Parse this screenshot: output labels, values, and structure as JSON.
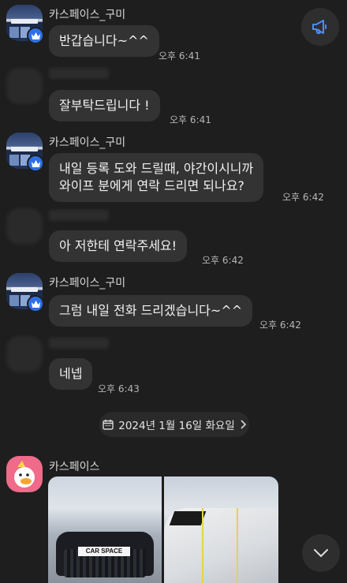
{
  "messages": [
    {
      "sender": "카스페이스_구미",
      "text": "반갑습니다~^^",
      "time": "오후 6:41"
    },
    {
      "text": "잘부탁드립니다 !",
      "time": "오후 6:41"
    },
    {
      "sender": "카스페이스_구미",
      "text": "내일 등록 도와 드릴때, 야간이시니까\n와이프 분에게 연락 드리면 되나요?",
      "time": "오후 6:42"
    },
    {
      "text": "아 저한테 연락주세요!",
      "time": "오후 6:42"
    },
    {
      "sender": "카스페이스_구미",
      "text": "그럼 내일 전화 드리겠습니다~^^",
      "time": "오후 6:42"
    },
    {
      "text": "네넵",
      "time": "오후 6:43"
    }
  ],
  "date_divider": "2024년 1월 16일 화요일",
  "last_sender": "카스페이스",
  "photo_left_text": "CAR SPACE",
  "icons": {
    "announce": "megaphone-icon",
    "scroll_down": "chevron-down-icon",
    "calendar": "calendar-icon",
    "verified": "crown-badge-icon"
  },
  "colors": {
    "background": "#1e1e1e",
    "bubble": "#333333",
    "badge": "#2f6fe4",
    "profile": "#f06a8a"
  }
}
